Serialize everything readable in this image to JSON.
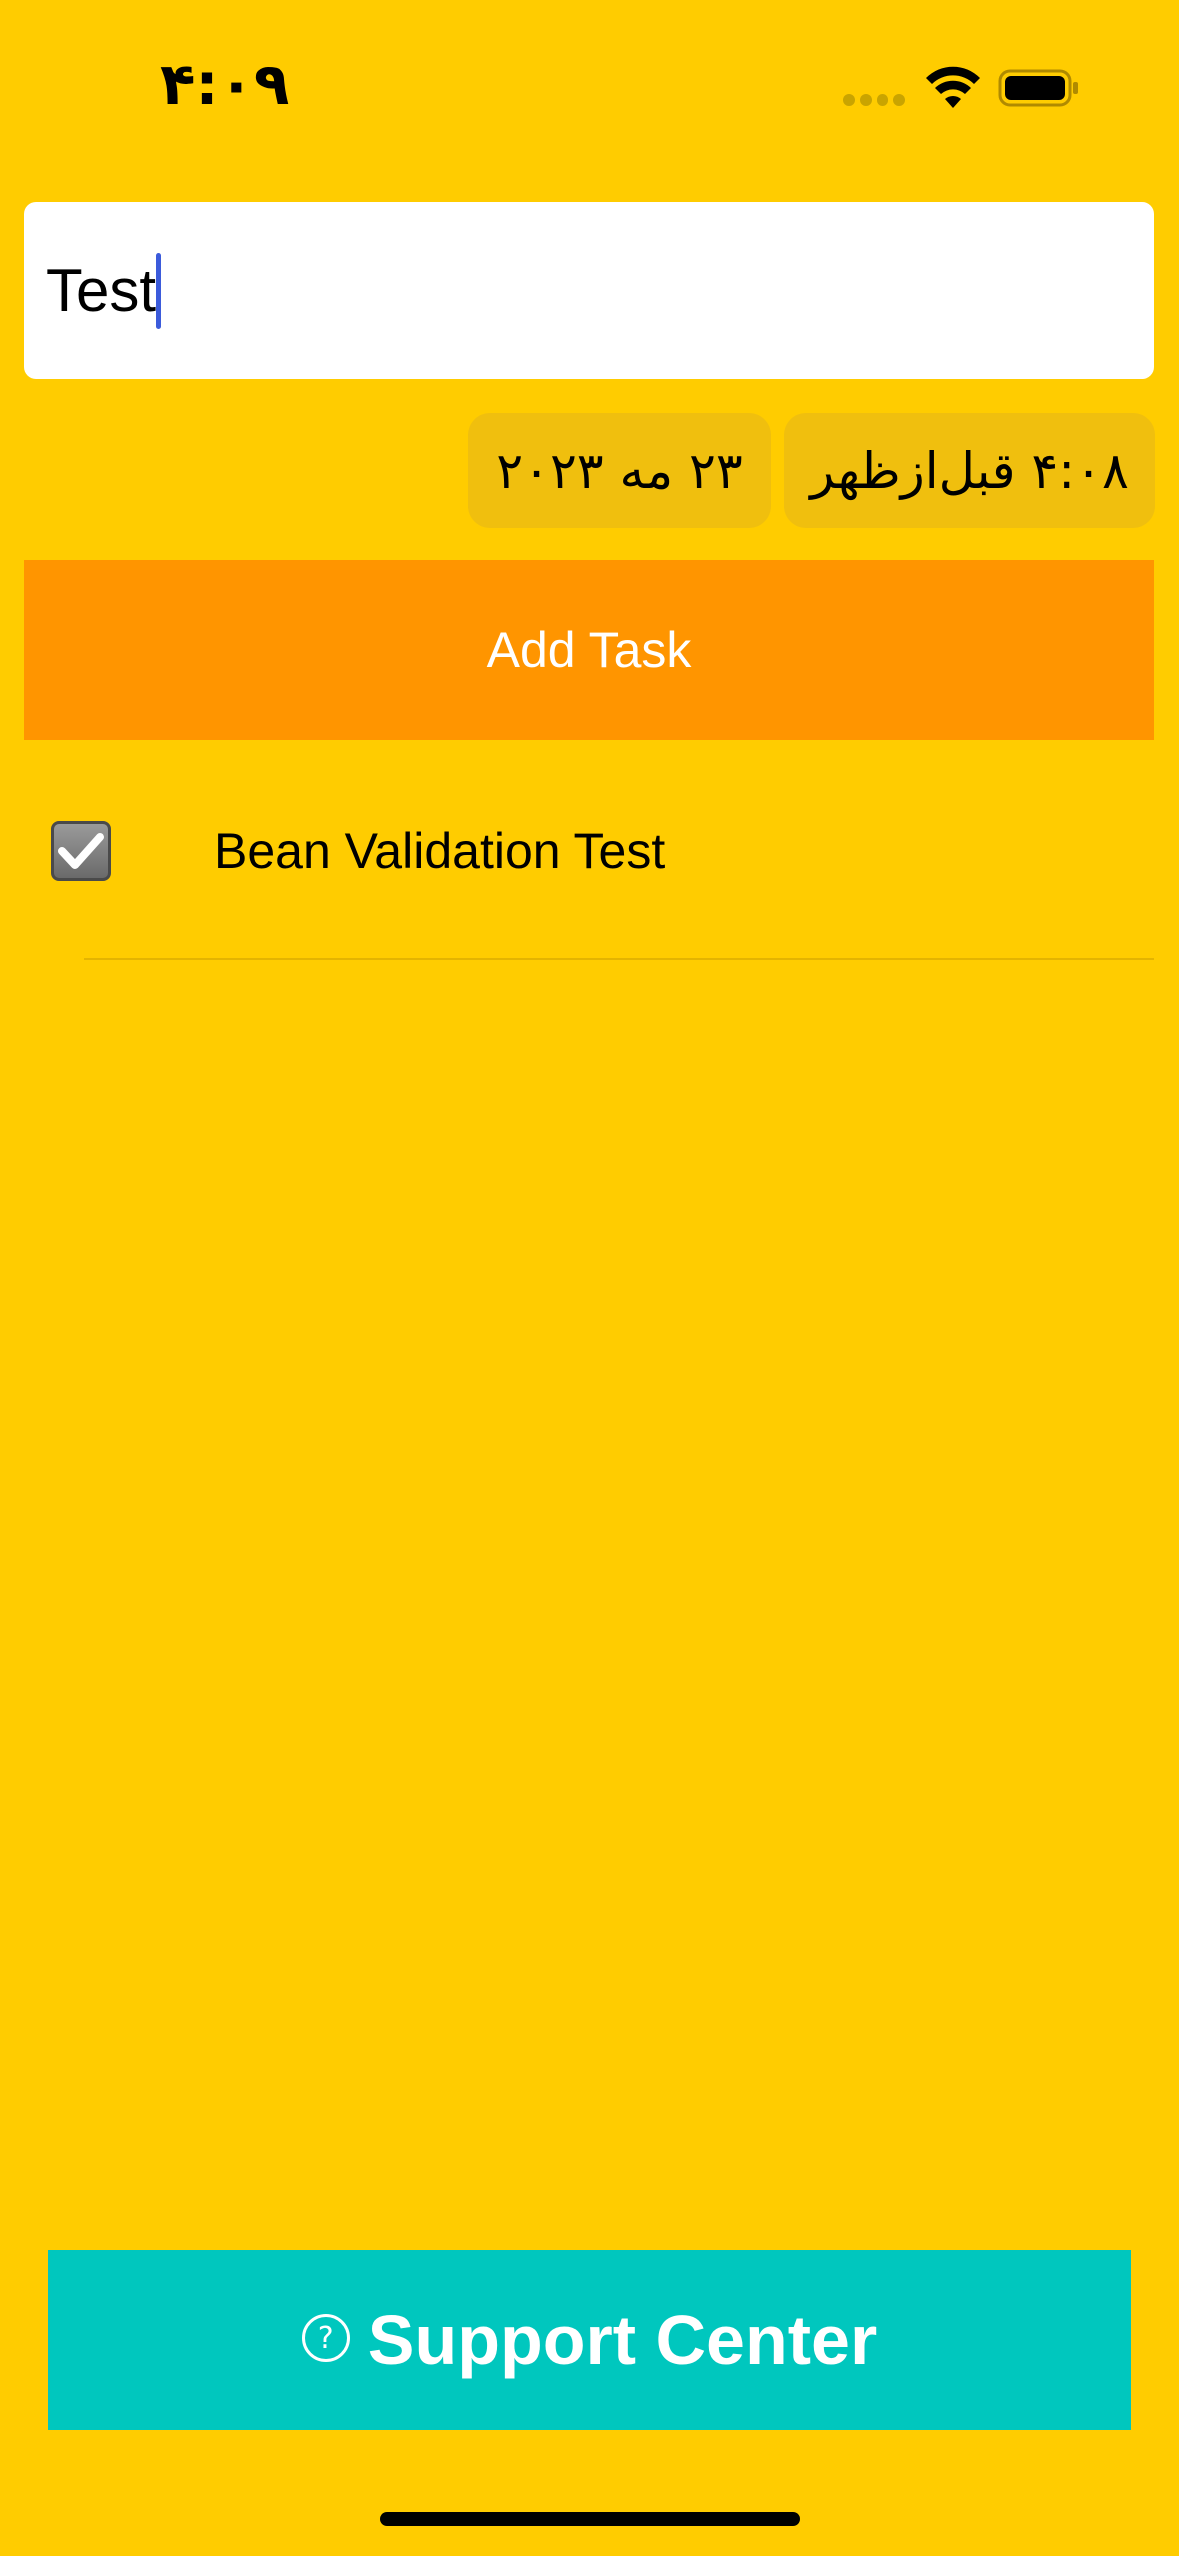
{
  "status_bar": {
    "time": "۴:۰۹"
  },
  "task_input": {
    "value": "Test"
  },
  "date_picker": {
    "date": "۲۳ مه ۲۰۲۳",
    "time": "۴:۰۸ قبل‌ازظهر"
  },
  "add_task_button": {
    "label": "Add Task"
  },
  "tasks": [
    {
      "label": "Bean Validation Test",
      "checked": true
    }
  ],
  "support_button": {
    "label": "Support Center",
    "icon": "question-circle-icon"
  },
  "colors": {
    "background": "#FFCC00",
    "add_task": "#FF9500",
    "support": "#00C7BE",
    "picker": "#F0BF0E"
  }
}
